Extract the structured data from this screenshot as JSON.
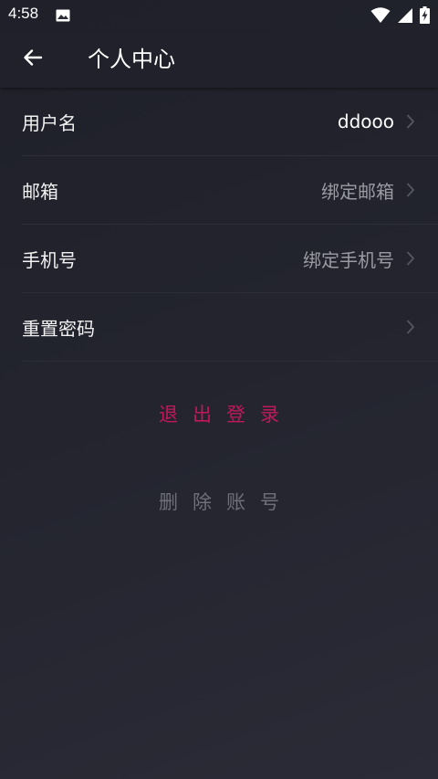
{
  "status_bar": {
    "time": "4:58"
  },
  "header": {
    "title": "个人中心",
    "back_icon": "arrow-left-icon"
  },
  "rows": [
    {
      "label": "用户名",
      "value": "ddooo"
    },
    {
      "label": "邮箱",
      "value": "绑定邮箱"
    },
    {
      "label": "手机号",
      "value": "绑定手机号"
    },
    {
      "label": "重置密码",
      "value": ""
    }
  ],
  "actions": {
    "logout": "退出登录",
    "delete_account": "删除账号"
  },
  "colors": {
    "background": "#23242e",
    "app_bar": "#20212a",
    "logout": "#c2185b",
    "delete_account": "#6e6f78",
    "value_filled": "#ffffff",
    "value_placeholder": "#9a9ba3",
    "chevron": "#55565f",
    "divider": "#2d2e38"
  }
}
